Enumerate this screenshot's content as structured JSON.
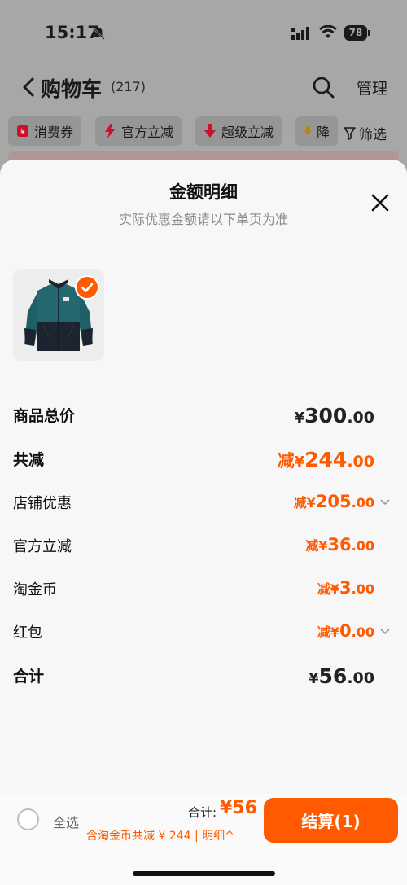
{
  "status_bar": {
    "time": "15:17",
    "battery": "78"
  },
  "header": {
    "title": "购物车",
    "count": "(217)",
    "manage": "管理"
  },
  "filters": [
    {
      "label": "消费券",
      "icon": "coupon-icon",
      "color": "#c9122a"
    },
    {
      "label": "官方立减",
      "icon": "lightning-icon",
      "color": "#c9122a"
    },
    {
      "label": "超级立减",
      "icon": "arrow-down-icon",
      "color": "#c9122a"
    },
    {
      "label": "降",
      "icon": "down-price-icon",
      "color": "#b9820a"
    }
  ],
  "filter_button": "筛选",
  "sheet": {
    "title": "金额明细",
    "subtitle": "实际优惠金额请以下单页为准",
    "rows": [
      {
        "label": "商品总价",
        "prefix": "",
        "yen": "¥",
        "int": "300",
        "dec": ".00"
      },
      {
        "label": "共减",
        "prefix": "减",
        "yen": "¥",
        "int": "244",
        "dec": ".00"
      },
      {
        "label": "店铺优惠",
        "prefix": "减",
        "yen": "¥",
        "int": "205",
        "dec": ".00"
      },
      {
        "label": "官方立减",
        "prefix": "减",
        "yen": "¥",
        "int": "36",
        "dec": ".00"
      },
      {
        "label": "淘金币",
        "prefix": "减",
        "yen": "¥",
        "int": "3",
        "dec": ".00"
      },
      {
        "label": "红包",
        "prefix": "减",
        "yen": "¥",
        "int": "0",
        "dec": ".00"
      },
      {
        "label": "合计",
        "prefix": "",
        "yen": "¥",
        "int": "56",
        "dec": ".00"
      }
    ]
  },
  "bottom": {
    "select_all": "全选",
    "total_label": "合计:",
    "total_value": "¥56",
    "saving": "含淘金币共减 ¥ 244 | 明细^",
    "checkout": "结算(1)"
  },
  "colors": {
    "accent": "#ff5a00",
    "sheet_bg": "#f7f7f7"
  }
}
